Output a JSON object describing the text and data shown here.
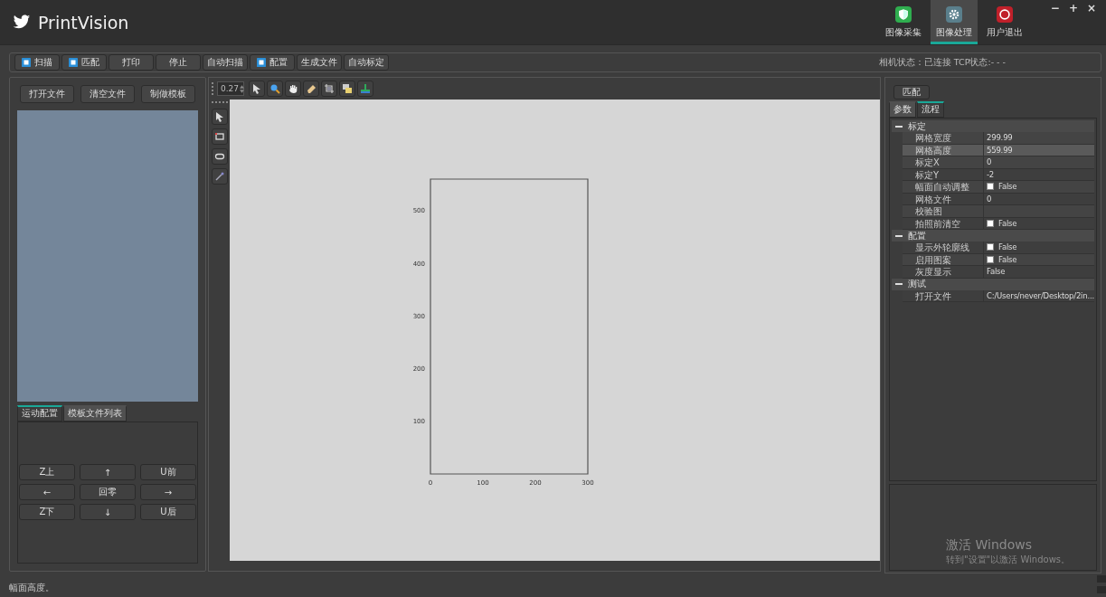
{
  "window": {
    "title": "PrintVision",
    "controls": [
      "−",
      "+",
      "×"
    ]
  },
  "nav_tabs": [
    {
      "label": "图像采集",
      "selected": false
    },
    {
      "label": "图像处理",
      "selected": true
    },
    {
      "label": "用户退出",
      "selected": false
    }
  ],
  "toolbar": {
    "buttons": [
      {
        "label": "扫描",
        "kind": "icon"
      },
      {
        "label": "匹配",
        "kind": "icon"
      },
      {
        "label": "打印",
        "kind": "plain"
      },
      {
        "label": "停止",
        "kind": "plain"
      },
      {
        "label": "自动扫描",
        "kind": "plain"
      },
      {
        "label": "配置",
        "kind": "icon"
      },
      {
        "label": "生成文件",
        "kind": "plain"
      },
      {
        "label": "自动标定",
        "kind": "plain"
      }
    ],
    "status": "相机状态：已连接  TCP状态:- - -"
  },
  "left_panel": {
    "buttons": [
      "打开文件",
      "清空文件",
      "制做模板"
    ],
    "tabs": [
      {
        "label": "运动配置",
        "selected": true
      },
      {
        "label": "模板文件列表",
        "selected": false
      }
    ],
    "motion_buttons": [
      "Z上",
      "↑",
      "U前",
      "←",
      "回零",
      "→",
      "Z下",
      "↓",
      "U后"
    ]
  },
  "viewer": {
    "zoom": "0.27",
    "chart_data": {
      "type": "line",
      "xlim": [
        0,
        300
      ],
      "ylim": [
        0,
        560
      ],
      "xticks": [
        0,
        100,
        200,
        300
      ],
      "yticks": [
        100,
        200,
        300,
        400,
        500
      ]
    }
  },
  "right_panel": {
    "button": "匹配",
    "tabs": [
      {
        "label": "参数",
        "selected": false
      },
      {
        "label": "流程",
        "selected": true
      }
    ],
    "groups": [
      {
        "name": "标定",
        "expanded": true,
        "rows": [
          {
            "name": "网格宽度",
            "kind": "text",
            "value": "299.99",
            "selected": false
          },
          {
            "name": "网格高度",
            "kind": "text",
            "value": "559.99",
            "selected": true
          },
          {
            "name": "标定X",
            "kind": "text",
            "value": "0",
            "selected": false
          },
          {
            "name": "标定Y",
            "kind": "text",
            "value": "-2",
            "selected": false
          },
          {
            "name": "幅面自动调整",
            "kind": "checkbox",
            "value": "False",
            "checked": false,
            "selected": false
          },
          {
            "name": "网格文件",
            "kind": "text",
            "value": "0",
            "selected": false
          },
          {
            "name": "校验图",
            "kind": "text",
            "selected": false
          },
          {
            "name": "拍照前清空",
            "kind": "checkbox",
            "value": "False",
            "checked": false,
            "selected": false
          }
        ]
      },
      {
        "name": "配置",
        "expanded": true,
        "rows": [
          {
            "name": "显示外轮廓线",
            "kind": "checkbox",
            "value": "False",
            "checked": false,
            "selected": false
          },
          {
            "name": "启用图案",
            "kind": "checkbox",
            "value": "False",
            "checked": false,
            "selected": false
          },
          {
            "name": "灰度显示",
            "kind": "text",
            "value": "False",
            "selected": false
          }
        ]
      },
      {
        "name": "测试",
        "expanded": true,
        "rows": [
          {
            "name": "打开文件",
            "kind": "text",
            "value": "C:/Users/never/Desktop/2in...",
            "selected": false
          }
        ]
      }
    ]
  },
  "activation_notice": {
    "title": "激活 Windows",
    "subtitle": "转到\"设置\"以激活 Windows。"
  },
  "status_bar": "幅面高度。"
}
